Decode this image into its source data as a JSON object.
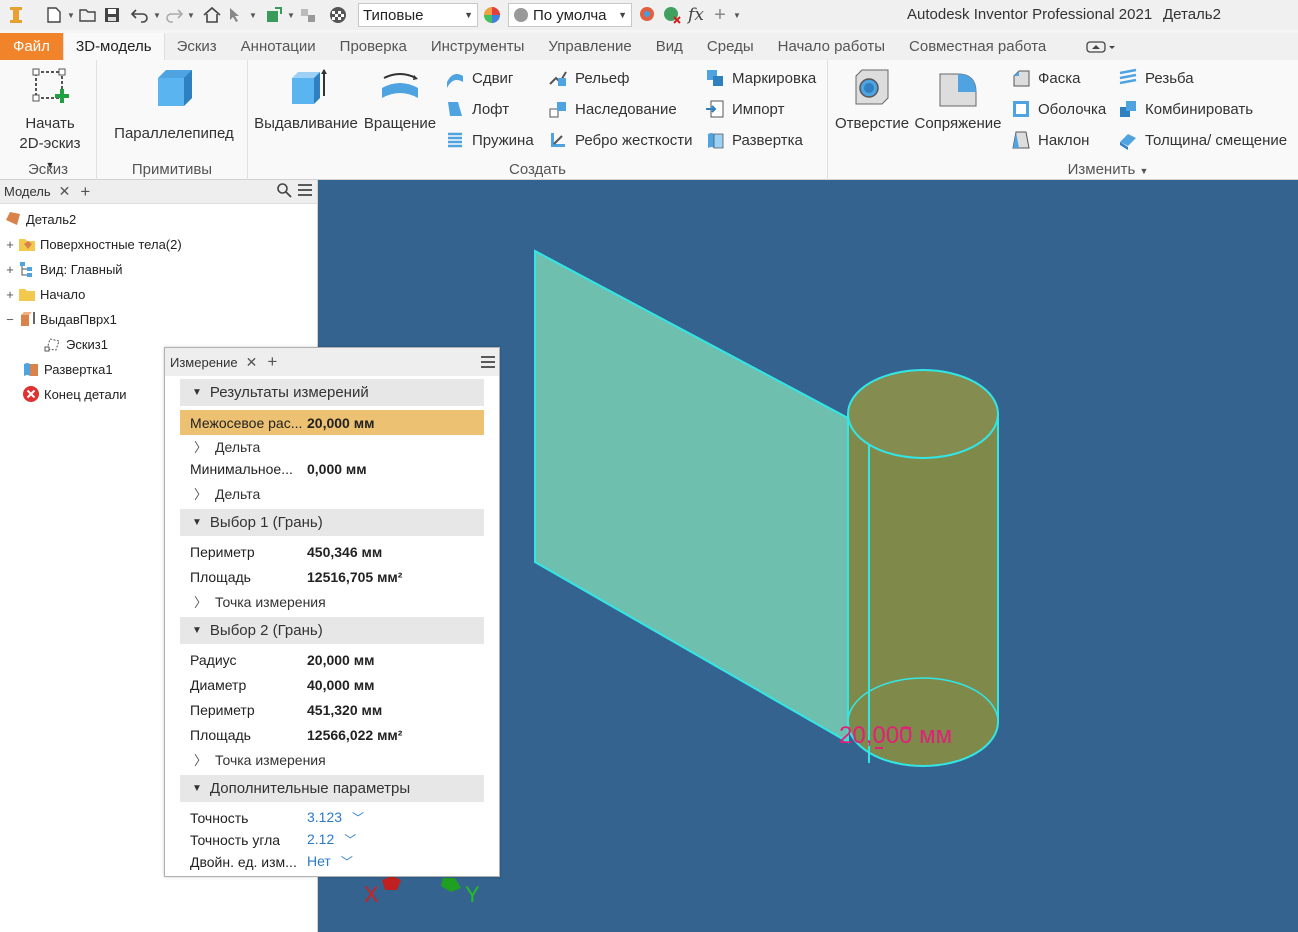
{
  "qat": {
    "appearance_combo": "Типовые",
    "material_combo": "По умолча",
    "fx_label": "fx"
  },
  "title": {
    "app": "Autodesk Inventor Professional 2021",
    "document": "Деталь2"
  },
  "tabs": [
    "Файл",
    "3D-модель",
    "Эскиз",
    "Аннотации",
    "Проверка",
    "Инструменты",
    "Управление",
    "Вид",
    "Среды",
    "Начало работы",
    "Совместная работа"
  ],
  "ribbon": {
    "sketch_group": {
      "label": "Эскиз",
      "start_sketch_line1": "Начать",
      "start_sketch_line2": "2D-эскиз"
    },
    "primitives_group": {
      "label": "Примитивы",
      "box": "Параллелепипед"
    },
    "create_group": {
      "label": "Создать",
      "extrude": "Выдавливание",
      "revolve": "Вращение",
      "sweep": "Сдвиг",
      "loft": "Лофт",
      "coil": "Пружина",
      "emboss": "Рельеф",
      "derive": "Наследование",
      "rib": "Ребро жесткости",
      "mark": "Маркировка",
      "import": "Импорт",
      "unwrap": "Развертка"
    },
    "modify_group": {
      "label": "Изменить",
      "hole": "Отверстие",
      "fillet": "Сопряжение",
      "chamfer": "Фаска",
      "shell": "Оболочка",
      "draft": "Наклон",
      "thread": "Резьба",
      "combine": "Комбинировать",
      "thicken": "Толщина/ смещение"
    }
  },
  "browser": {
    "tab": "Модель",
    "items": [
      {
        "label": "Деталь2"
      },
      {
        "label": "Поверхностные тела(2)"
      },
      {
        "label": "Вид: Главный"
      },
      {
        "label": "Начало"
      },
      {
        "label": "ВыдавПврх1"
      },
      {
        "label": "Эскиз1"
      },
      {
        "label": "Развертка1"
      },
      {
        "label": "Конец детали"
      }
    ]
  },
  "measure": {
    "tab": "Измерение",
    "results_header": "Результаты измерений",
    "center_dist_label": "Межосевое рас...",
    "center_dist_value": "20,000 мм",
    "delta1": "Дельта",
    "min_label": "Минимальное...",
    "min_value": "0,000 мм",
    "delta2": "Дельта",
    "sel1_header": "Выбор 1 (Грань)",
    "sel1_perimeter_label": "Периметр",
    "sel1_perimeter_value": "450,346 мм",
    "sel1_area_label": "Площадь",
    "sel1_area_value": "12516,705 мм²",
    "sel1_point": "Точка измерения",
    "sel2_header": "Выбор 2 (Грань)",
    "sel2_radius_label": "Радиус",
    "sel2_radius_value": "20,000 мм",
    "sel2_diameter_label": "Диаметр",
    "sel2_diameter_value": "40,000 мм",
    "sel2_perimeter_label": "Периметр",
    "sel2_perimeter_value": "451,320 мм",
    "sel2_area_label": "Площадь",
    "sel2_area_value": "12566,022 мм²",
    "sel2_point": "Точка измерения",
    "extra_header": "Дополнительные параметры",
    "precision_label": "Точность",
    "precision_value": "3.123",
    "angle_precision_label": "Точность угла",
    "angle_precision_value": "2.12",
    "dual_units_label": "Двойн. ед. изм...",
    "dual_units_value": "Нет"
  },
  "viewport": {
    "dimension_label": "20,000 мм",
    "axis_x": "X",
    "axis_y": "Y"
  },
  "colors": {
    "viewport_bg": "#34638f",
    "accent_file": "#f1842a",
    "highlight_row": "#ecc172",
    "plane_fill": "#6fbfae",
    "cylinder_fill": "#7f8a4a",
    "edge_highlight": "#33e6e6",
    "dimension_text": "#e0207a"
  }
}
